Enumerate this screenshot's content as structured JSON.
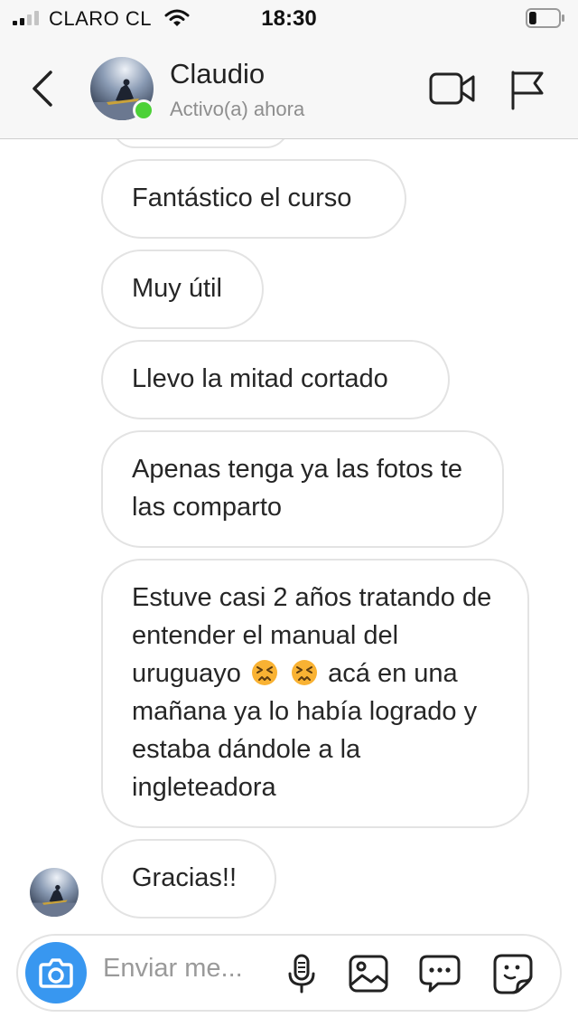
{
  "status_bar": {
    "carrier": "CLARO CL",
    "time": "18:30",
    "signal_bars": 2,
    "signal_total": 4,
    "battery_level": 0.25
  },
  "header": {
    "name": "Claudio",
    "status": "Activo(a) ahora",
    "online": true
  },
  "messages": [
    {
      "text": "Fantástico el curso"
    },
    {
      "text": "Muy útil"
    },
    {
      "text": "Llevo la mitad cortado"
    },
    {
      "text": "Apenas tenga ya las fotos te las comparto"
    },
    {
      "text_before_emoji": "Estuve casi 2 años tratando de entender el manual del uruguayo",
      "emoji": "confounded-face",
      "emoji_count": 2,
      "text_after_emoji": "acá en una mañana ya lo había logrado y estaba dándole a la ingleteadora"
    },
    {
      "text": "Gracias!!"
    }
  ],
  "composer": {
    "placeholder": "Enviar me..."
  },
  "colors": {
    "accent": "#3897f0",
    "online": "#4cd137",
    "bubble_border": "#e3e3e3",
    "emoji_face": "#f9b233"
  },
  "icons": {
    "back": "chevron-left-icon",
    "video": "video-camera-icon",
    "flag": "flag-icon",
    "camera": "camera-icon",
    "mic": "microphone-icon",
    "gallery": "image-icon",
    "quick_reply": "chat-bubble-icon",
    "sticker": "sticker-icon"
  }
}
